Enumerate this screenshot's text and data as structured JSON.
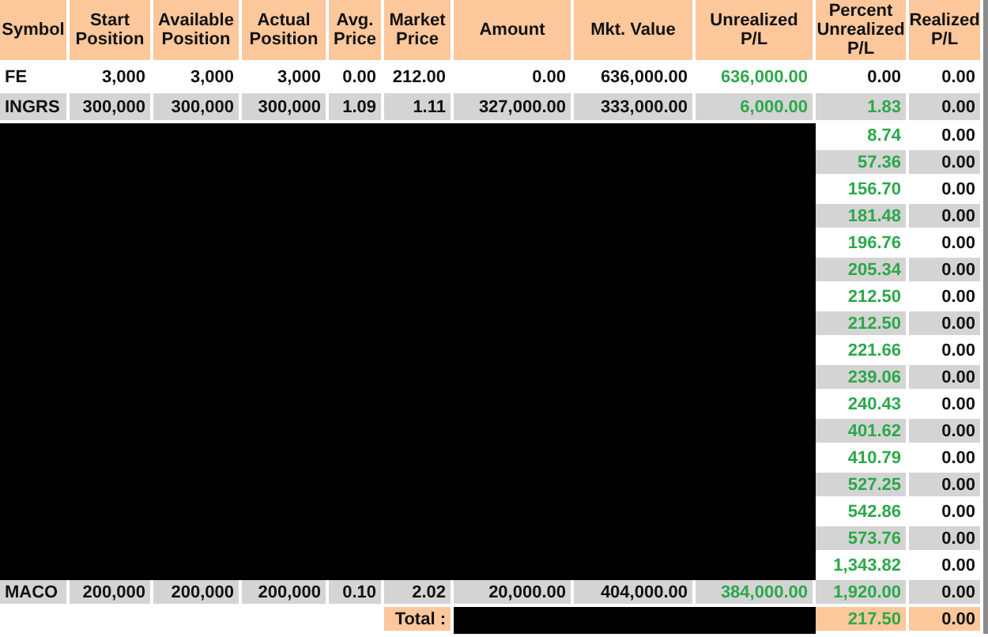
{
  "columns": [
    "Symbol",
    "Start Position",
    "Available Position",
    "Actual Position",
    "Avg. Price",
    "Market Price",
    "Amount",
    "Mkt. Value",
    "Unrealized P/L",
    "Percent Unrealized P/L",
    "Realized P/L"
  ],
  "rows": [
    {
      "kind": "full",
      "shaded": false,
      "unrealized_gain": true,
      "percent_gain": false,
      "cells": [
        "FE",
        "3,000",
        "3,000",
        "3,000",
        "0.00",
        "212.00",
        "0.00",
        "636,000.00",
        "636,000.00",
        "0.00",
        "0.00"
      ]
    },
    {
      "kind": "full",
      "shaded": true,
      "unrealized_gain": true,
      "percent_gain": true,
      "cells": [
        "INGRS",
        "300,000",
        "300,000",
        "300,000",
        "1.09",
        "1.11",
        "327,000.00",
        "333,000.00",
        "6,000.00",
        "1.83",
        "0.00"
      ]
    },
    {
      "kind": "redacted",
      "shaded": false,
      "percent_gain": true,
      "cells": [
        "8.74",
        "0.00"
      ]
    },
    {
      "kind": "redacted",
      "shaded": true,
      "percent_gain": true,
      "cells": [
        "57.36",
        "0.00"
      ]
    },
    {
      "kind": "redacted",
      "shaded": false,
      "percent_gain": true,
      "cells": [
        "156.70",
        "0.00"
      ]
    },
    {
      "kind": "redacted",
      "shaded": true,
      "percent_gain": true,
      "cells": [
        "181.48",
        "0.00"
      ]
    },
    {
      "kind": "redacted",
      "shaded": false,
      "percent_gain": true,
      "cells": [
        "196.76",
        "0.00"
      ]
    },
    {
      "kind": "redacted",
      "shaded": true,
      "percent_gain": true,
      "cells": [
        "205.34",
        "0.00"
      ]
    },
    {
      "kind": "redacted",
      "shaded": false,
      "percent_gain": true,
      "cells": [
        "212.50",
        "0.00"
      ]
    },
    {
      "kind": "redacted",
      "shaded": true,
      "percent_gain": true,
      "cells": [
        "212.50",
        "0.00"
      ]
    },
    {
      "kind": "redacted",
      "shaded": false,
      "percent_gain": true,
      "cells": [
        "221.66",
        "0.00"
      ]
    },
    {
      "kind": "redacted",
      "shaded": true,
      "percent_gain": true,
      "cells": [
        "239.06",
        "0.00"
      ]
    },
    {
      "kind": "redacted",
      "shaded": false,
      "percent_gain": true,
      "cells": [
        "240.43",
        "0.00"
      ]
    },
    {
      "kind": "redacted",
      "shaded": true,
      "percent_gain": true,
      "cells": [
        "401.62",
        "0.00"
      ]
    },
    {
      "kind": "redacted",
      "shaded": false,
      "percent_gain": true,
      "cells": [
        "410.79",
        "0.00"
      ]
    },
    {
      "kind": "redacted",
      "shaded": true,
      "percent_gain": true,
      "cells": [
        "527.25",
        "0.00"
      ]
    },
    {
      "kind": "redacted",
      "shaded": false,
      "percent_gain": true,
      "cells": [
        "542.86",
        "0.00"
      ]
    },
    {
      "kind": "redacted",
      "shaded": true,
      "percent_gain": true,
      "cells": [
        "573.76",
        "0.00"
      ]
    },
    {
      "kind": "redacted",
      "shaded": false,
      "percent_gain": true,
      "cells": [
        "1,343.82",
        "0.00"
      ]
    },
    {
      "kind": "full",
      "shaded": true,
      "unrealized_gain": true,
      "percent_gain": true,
      "cells": [
        "MACO",
        "200,000",
        "200,000",
        "200,000",
        "0.10",
        "2.02",
        "20,000.00",
        "404,000.00",
        "384,000.00",
        "1,920.00",
        "0.00"
      ]
    }
  ],
  "total": {
    "label": "Total :",
    "percent": "217.50",
    "realized": "0.00",
    "percent_gain": true
  }
}
